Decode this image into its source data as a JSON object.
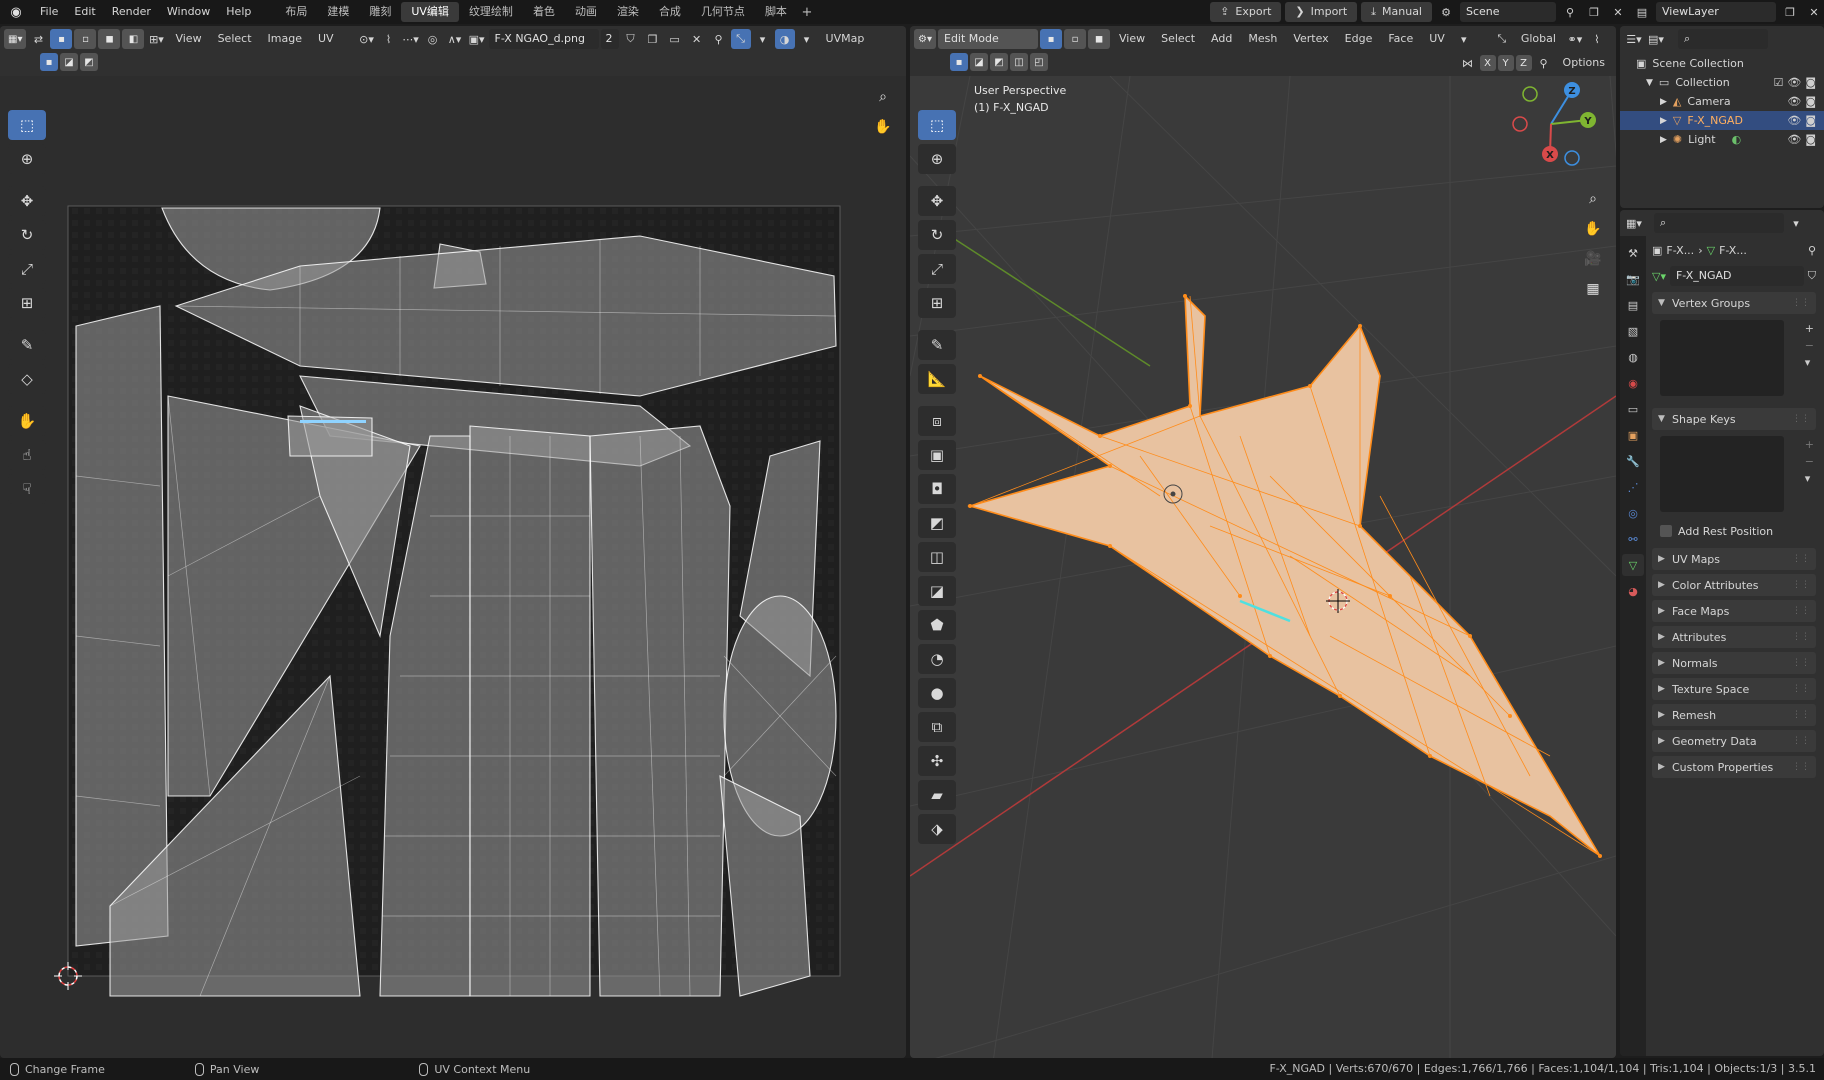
{
  "app": {
    "menus": [
      "File",
      "Edit",
      "Render",
      "Window",
      "Help"
    ]
  },
  "workspaces": [
    "布局",
    "建模",
    "雕刻",
    "UV编辑",
    "纹理绘制",
    "着色",
    "动画",
    "渲染",
    "合成",
    "几何节点",
    "脚本"
  ],
  "topbar": {
    "export_label": "Export",
    "import_label": "Import",
    "manual_label": "Manual",
    "scene": "Scene",
    "view_layer": "ViewLayer"
  },
  "uv_editor": {
    "menus": [
      "View",
      "Select",
      "Image",
      "UV"
    ],
    "image_name": "F-X NGAO_d.png",
    "users": "2",
    "uvmap_label": "UVMap"
  },
  "viewport": {
    "mode": "Edit Mode",
    "menus": [
      "View",
      "Select",
      "Add",
      "Mesh",
      "Vertex",
      "Edge",
      "Face",
      "UV"
    ],
    "orientation": "Global",
    "axes": [
      "X",
      "Y",
      "Z"
    ],
    "options_label": "Options",
    "view_name": "User Perspective",
    "object_label": "(1) F-X_NGAD",
    "gizmo": {
      "x": "X",
      "y": "Y",
      "z": "Z"
    }
  },
  "outliner": {
    "root": "Scene Collection",
    "collection": "Collection",
    "items": [
      {
        "name": "Camera"
      },
      {
        "name": "F-X_NGAD"
      },
      {
        "name": "Light"
      }
    ]
  },
  "properties": {
    "breadcrumb_obj": "F-X...",
    "breadcrumb_data": "F-X...",
    "mesh_name": "F-X_NGAD",
    "panels": {
      "vertex_groups": "Vertex Groups",
      "shape_keys": "Shape Keys",
      "add_rest_position": "Add Rest Position",
      "uv_maps": "UV Maps",
      "color_attributes": "Color Attributes",
      "face_maps": "Face Maps",
      "attributes": "Attributes",
      "normals": "Normals",
      "texture_space": "Texture Space",
      "remesh": "Remesh",
      "geometry_data": "Geometry Data",
      "custom_properties": "Custom Properties"
    }
  },
  "statusbar": {
    "hint1": "Change Frame",
    "hint2": "Pan View",
    "hint3": "UV Context Menu",
    "stats": "F-X_NGAD | Verts:670/670 | Edges:1,766/1,766 | Faces:1,104/1,104 | Tris:1,104 | Objects:1/3 | 3.5.1"
  },
  "colors": {
    "accent_blue": "#4772b3",
    "selection_orange": "#ff8c1a",
    "x_axis": "#d94a4a",
    "y_axis": "#7fb531",
    "z_axis": "#3d8fe0"
  }
}
